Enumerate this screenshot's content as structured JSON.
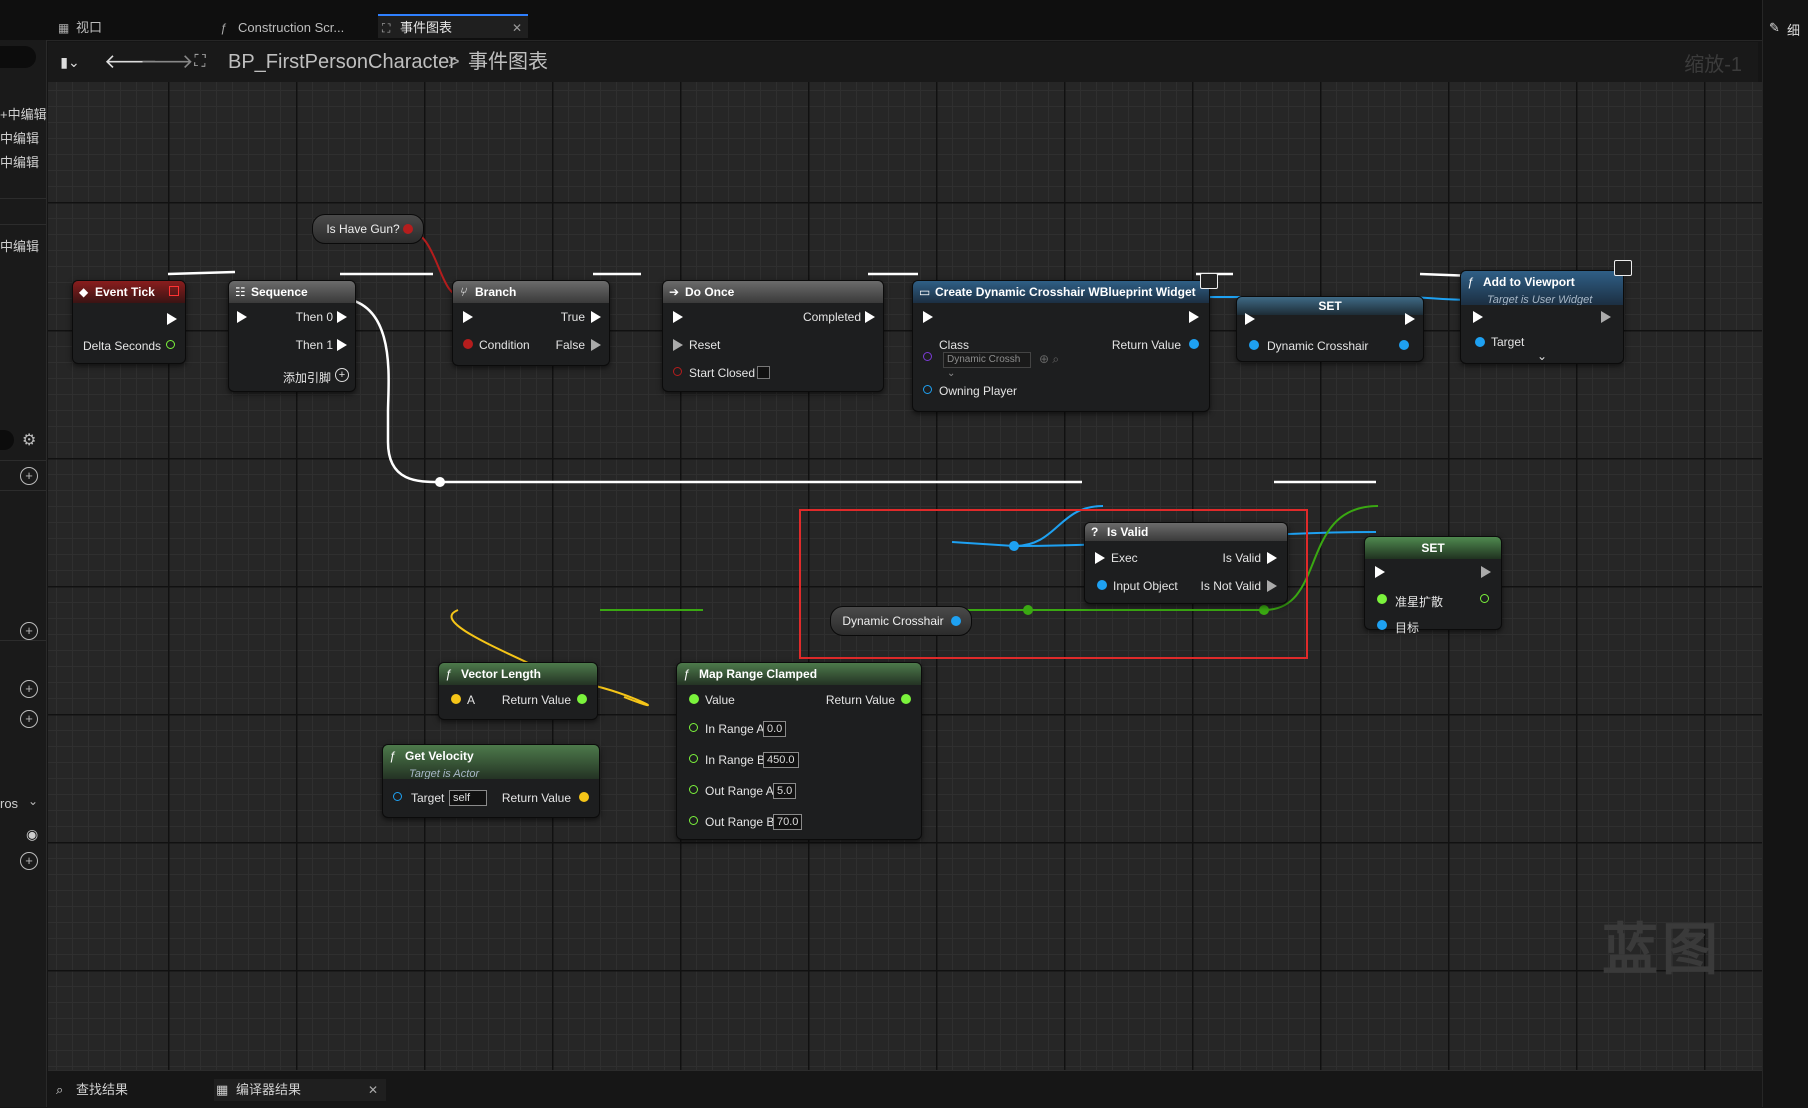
{
  "tabs": [
    {
      "label": "视口",
      "icon": "grid-icon"
    },
    {
      "label": "Construction Scr...",
      "icon": "function-icon"
    },
    {
      "label": "事件图表",
      "icon": "graph-icon",
      "active": true
    }
  ],
  "breadcrumb": {
    "blueprint": "BP_FirstPersonCharacter",
    "separator": ">",
    "graph": "事件图表"
  },
  "zoom_label": "缩放-1",
  "left_panel": {
    "items": [
      "+中编辑",
      "中编辑",
      "中编辑",
      "中编辑"
    ],
    "macros_label": "ros"
  },
  "right_strip": {
    "label": "细"
  },
  "nodes": {
    "is_have_gun": {
      "label": "Is Have Gun?"
    },
    "event_tick": {
      "title": "Event Tick",
      "delta": "Delta Seconds"
    },
    "sequence": {
      "title": "Sequence",
      "then0": "Then 0",
      "then1": "Then 1",
      "add_pin": "添加引脚"
    },
    "branch": {
      "title": "Branch",
      "condition": "Condition",
      "true_label": "True",
      "false_label": "False"
    },
    "do_once": {
      "title": "Do Once",
      "completed": "Completed",
      "reset": "Reset",
      "start_closed": "Start Closed"
    },
    "create_widget": {
      "title": "Create Dynamic Crosshair WBlueprint Widget",
      "class": "Class",
      "class_value": "Dynamic Crossh",
      "return_value": "Return Value",
      "owning_player": "Owning Player"
    },
    "set1": {
      "title": "SET",
      "var": "Dynamic Crosshair"
    },
    "add_to_viewport": {
      "title": "Add to Viewport",
      "subtitle": "Target is User Widget",
      "target": "Target"
    },
    "is_valid": {
      "title": "Is Valid",
      "exec": "Exec",
      "input_object": "Input Object",
      "is_valid_out": "Is Valid",
      "is_not_valid": "Is Not Valid"
    },
    "dynamic_crosshair_get": {
      "label": "Dynamic Crosshair"
    },
    "set2": {
      "title": "SET",
      "var": "准星扩散",
      "target": "目标"
    },
    "vector_length": {
      "title": "Vector Length",
      "a": "A",
      "return_value": "Return Value"
    },
    "get_velocity": {
      "title": "Get Velocity",
      "subtitle": "Target is Actor",
      "target": "Target",
      "target_value": "self",
      "return_value": "Return Value"
    },
    "map_range": {
      "title": "Map Range Clamped",
      "value": "Value",
      "return_value": "Return Value",
      "in_range_a": "In Range A",
      "in_range_a_val": "0.0",
      "in_range_b": "In Range B",
      "in_range_b_val": "450.0",
      "out_range_a": "Out Range A",
      "out_range_a_val": "5.0",
      "out_range_b": "Out Range B",
      "out_range_b_val": "70.0"
    }
  },
  "watermark": "蓝图",
  "bottom_tabs": [
    {
      "label": "查找结果",
      "icon": "search-icon"
    },
    {
      "label": "编译器结果",
      "icon": "compiler-icon"
    }
  ],
  "colors": {
    "exec": "#ffffff",
    "float": "#7bf33c",
    "object": "#1ea1f2",
    "bool": "#b51d1d",
    "vector": "#f5c518",
    "highlight": "#e02a2a"
  }
}
